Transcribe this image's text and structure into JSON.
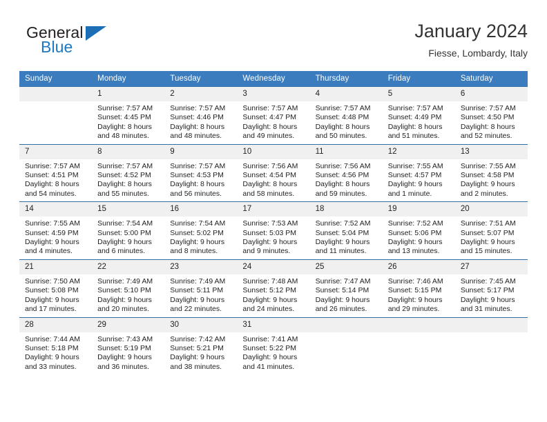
{
  "brand": {
    "name_part1": "General",
    "name_part2": "Blue",
    "logo_icon": "triangle-logo-icon",
    "colors": {
      "blue": "#1c77c3",
      "dark": "#231f20"
    }
  },
  "header": {
    "title": "January 2024",
    "subtitle": "Fiesse, Lombardy, Italy"
  },
  "calendar": {
    "header_bg": "#3a7cbe",
    "daynum_bg": "#f0f0f0",
    "border_color": "#2f6da8",
    "weekdays": [
      "Sunday",
      "Monday",
      "Tuesday",
      "Wednesday",
      "Thursday",
      "Friday",
      "Saturday"
    ],
    "weeks": [
      [
        {
          "day": "",
          "empty": true
        },
        {
          "day": "1",
          "sunrise": "Sunrise: 7:57 AM",
          "sunset": "Sunset: 4:45 PM",
          "daylight_line1": "Daylight: 8 hours",
          "daylight_line2": "and 48 minutes."
        },
        {
          "day": "2",
          "sunrise": "Sunrise: 7:57 AM",
          "sunset": "Sunset: 4:46 PM",
          "daylight_line1": "Daylight: 8 hours",
          "daylight_line2": "and 48 minutes."
        },
        {
          "day": "3",
          "sunrise": "Sunrise: 7:57 AM",
          "sunset": "Sunset: 4:47 PM",
          "daylight_line1": "Daylight: 8 hours",
          "daylight_line2": "and 49 minutes."
        },
        {
          "day": "4",
          "sunrise": "Sunrise: 7:57 AM",
          "sunset": "Sunset: 4:48 PM",
          "daylight_line1": "Daylight: 8 hours",
          "daylight_line2": "and 50 minutes."
        },
        {
          "day": "5",
          "sunrise": "Sunrise: 7:57 AM",
          "sunset": "Sunset: 4:49 PM",
          "daylight_line1": "Daylight: 8 hours",
          "daylight_line2": "and 51 minutes."
        },
        {
          "day": "6",
          "sunrise": "Sunrise: 7:57 AM",
          "sunset": "Sunset: 4:50 PM",
          "daylight_line1": "Daylight: 8 hours",
          "daylight_line2": "and 52 minutes."
        }
      ],
      [
        {
          "day": "7",
          "sunrise": "Sunrise: 7:57 AM",
          "sunset": "Sunset: 4:51 PM",
          "daylight_line1": "Daylight: 8 hours",
          "daylight_line2": "and 54 minutes."
        },
        {
          "day": "8",
          "sunrise": "Sunrise: 7:57 AM",
          "sunset": "Sunset: 4:52 PM",
          "daylight_line1": "Daylight: 8 hours",
          "daylight_line2": "and 55 minutes."
        },
        {
          "day": "9",
          "sunrise": "Sunrise: 7:57 AM",
          "sunset": "Sunset: 4:53 PM",
          "daylight_line1": "Daylight: 8 hours",
          "daylight_line2": "and 56 minutes."
        },
        {
          "day": "10",
          "sunrise": "Sunrise: 7:56 AM",
          "sunset": "Sunset: 4:54 PM",
          "daylight_line1": "Daylight: 8 hours",
          "daylight_line2": "and 58 minutes."
        },
        {
          "day": "11",
          "sunrise": "Sunrise: 7:56 AM",
          "sunset": "Sunset: 4:56 PM",
          "daylight_line1": "Daylight: 8 hours",
          "daylight_line2": "and 59 minutes."
        },
        {
          "day": "12",
          "sunrise": "Sunrise: 7:55 AM",
          "sunset": "Sunset: 4:57 PM",
          "daylight_line1": "Daylight: 9 hours",
          "daylight_line2": "and 1 minute."
        },
        {
          "day": "13",
          "sunrise": "Sunrise: 7:55 AM",
          "sunset": "Sunset: 4:58 PM",
          "daylight_line1": "Daylight: 9 hours",
          "daylight_line2": "and 2 minutes."
        }
      ],
      [
        {
          "day": "14",
          "sunrise": "Sunrise: 7:55 AM",
          "sunset": "Sunset: 4:59 PM",
          "daylight_line1": "Daylight: 9 hours",
          "daylight_line2": "and 4 minutes."
        },
        {
          "day": "15",
          "sunrise": "Sunrise: 7:54 AM",
          "sunset": "Sunset: 5:00 PM",
          "daylight_line1": "Daylight: 9 hours",
          "daylight_line2": "and 6 minutes."
        },
        {
          "day": "16",
          "sunrise": "Sunrise: 7:54 AM",
          "sunset": "Sunset: 5:02 PM",
          "daylight_line1": "Daylight: 9 hours",
          "daylight_line2": "and 8 minutes."
        },
        {
          "day": "17",
          "sunrise": "Sunrise: 7:53 AM",
          "sunset": "Sunset: 5:03 PM",
          "daylight_line1": "Daylight: 9 hours",
          "daylight_line2": "and 9 minutes."
        },
        {
          "day": "18",
          "sunrise": "Sunrise: 7:52 AM",
          "sunset": "Sunset: 5:04 PM",
          "daylight_line1": "Daylight: 9 hours",
          "daylight_line2": "and 11 minutes."
        },
        {
          "day": "19",
          "sunrise": "Sunrise: 7:52 AM",
          "sunset": "Sunset: 5:06 PM",
          "daylight_line1": "Daylight: 9 hours",
          "daylight_line2": "and 13 minutes."
        },
        {
          "day": "20",
          "sunrise": "Sunrise: 7:51 AM",
          "sunset": "Sunset: 5:07 PM",
          "daylight_line1": "Daylight: 9 hours",
          "daylight_line2": "and 15 minutes."
        }
      ],
      [
        {
          "day": "21",
          "sunrise": "Sunrise: 7:50 AM",
          "sunset": "Sunset: 5:08 PM",
          "daylight_line1": "Daylight: 9 hours",
          "daylight_line2": "and 17 minutes."
        },
        {
          "day": "22",
          "sunrise": "Sunrise: 7:49 AM",
          "sunset": "Sunset: 5:10 PM",
          "daylight_line1": "Daylight: 9 hours",
          "daylight_line2": "and 20 minutes."
        },
        {
          "day": "23",
          "sunrise": "Sunrise: 7:49 AM",
          "sunset": "Sunset: 5:11 PM",
          "daylight_line1": "Daylight: 9 hours",
          "daylight_line2": "and 22 minutes."
        },
        {
          "day": "24",
          "sunrise": "Sunrise: 7:48 AM",
          "sunset": "Sunset: 5:12 PM",
          "daylight_line1": "Daylight: 9 hours",
          "daylight_line2": "and 24 minutes."
        },
        {
          "day": "25",
          "sunrise": "Sunrise: 7:47 AM",
          "sunset": "Sunset: 5:14 PM",
          "daylight_line1": "Daylight: 9 hours",
          "daylight_line2": "and 26 minutes."
        },
        {
          "day": "26",
          "sunrise": "Sunrise: 7:46 AM",
          "sunset": "Sunset: 5:15 PM",
          "daylight_line1": "Daylight: 9 hours",
          "daylight_line2": "and 29 minutes."
        },
        {
          "day": "27",
          "sunrise": "Sunrise: 7:45 AM",
          "sunset": "Sunset: 5:17 PM",
          "daylight_line1": "Daylight: 9 hours",
          "daylight_line2": "and 31 minutes."
        }
      ],
      [
        {
          "day": "28",
          "sunrise": "Sunrise: 7:44 AM",
          "sunset": "Sunset: 5:18 PM",
          "daylight_line1": "Daylight: 9 hours",
          "daylight_line2": "and 33 minutes."
        },
        {
          "day": "29",
          "sunrise": "Sunrise: 7:43 AM",
          "sunset": "Sunset: 5:19 PM",
          "daylight_line1": "Daylight: 9 hours",
          "daylight_line2": "and 36 minutes."
        },
        {
          "day": "30",
          "sunrise": "Sunrise: 7:42 AM",
          "sunset": "Sunset: 5:21 PM",
          "daylight_line1": "Daylight: 9 hours",
          "daylight_line2": "and 38 minutes."
        },
        {
          "day": "31",
          "sunrise": "Sunrise: 7:41 AM",
          "sunset": "Sunset: 5:22 PM",
          "daylight_line1": "Daylight: 9 hours",
          "daylight_line2": "and 41 minutes."
        },
        {
          "day": "",
          "empty": true
        },
        {
          "day": "",
          "empty": true
        },
        {
          "day": "",
          "empty": true
        }
      ]
    ]
  }
}
